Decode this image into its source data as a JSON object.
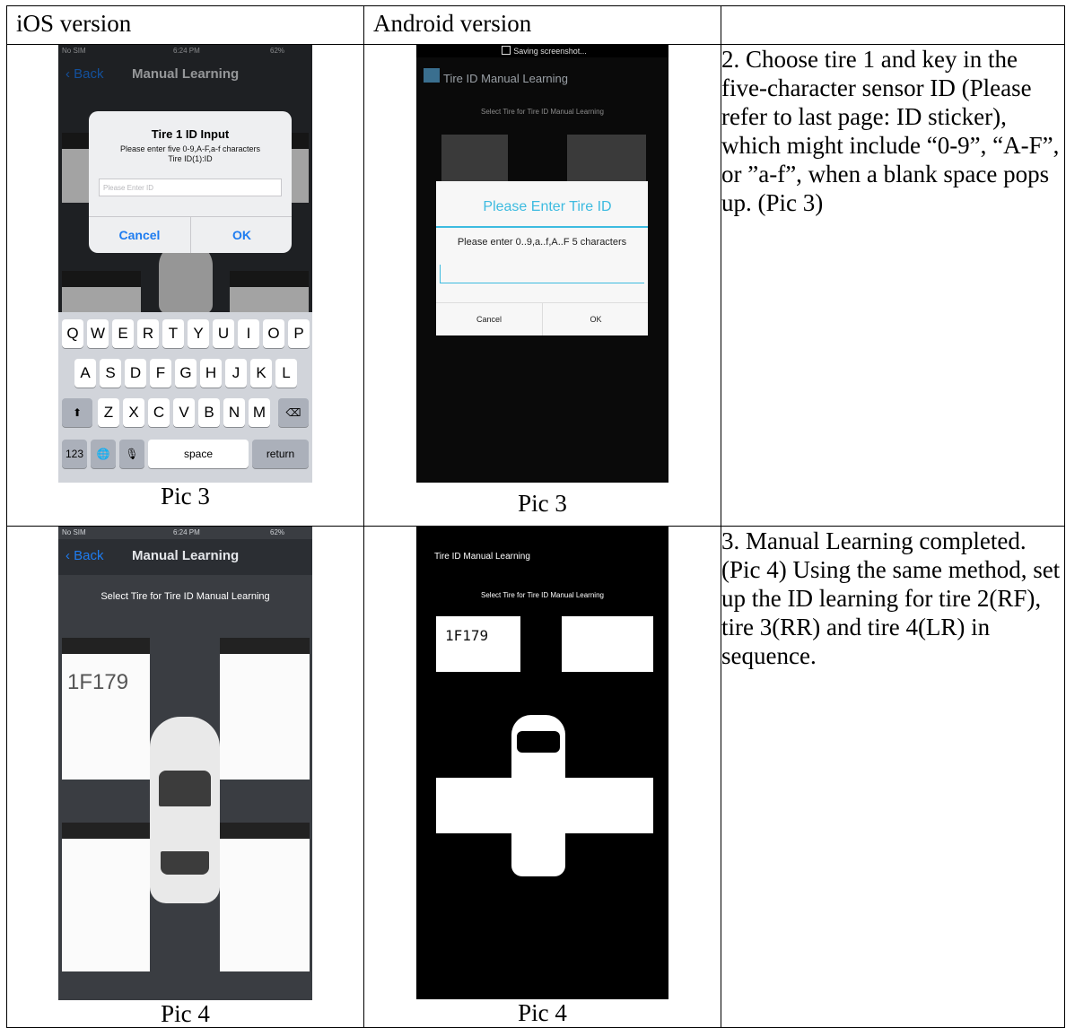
{
  "headers": {
    "ios": "iOS version",
    "android": "Android version",
    "empty": ""
  },
  "row1": {
    "ios": {
      "status_carrier": "No SIM",
      "status_time": "6:24 PM",
      "status_battery": "62%",
      "back": "Back",
      "title": "Manual Learning",
      "dialog_title": "Tire 1 ID Input",
      "dialog_msg1": "Please enter five 0-9,A-F,a-f characters",
      "dialog_msg2": "Tire ID(1):ID",
      "dialog_placeholder": "Please Enter ID",
      "cancel": "Cancel",
      "ok": "OK",
      "keys_row1": [
        "Q",
        "W",
        "E",
        "R",
        "T",
        "Y",
        "U",
        "I",
        "O",
        "P"
      ],
      "keys_row2": [
        "A",
        "S",
        "D",
        "F",
        "G",
        "H",
        "J",
        "K",
        "L"
      ],
      "keys_row3": [
        "Z",
        "X",
        "C",
        "V",
        "B",
        "N",
        "M"
      ],
      "key_123": "123",
      "key_space": "space",
      "key_return": "return"
    },
    "android": {
      "status": "Saving screenshot...",
      "title": "Tire ID Manual Learning",
      "subtitle": "Select Tire for Tire ID Manual Learning",
      "dialog_title": "Please Enter Tire ID",
      "dialog_msg": "Please enter 0..9,a..f,A..F 5 characters",
      "cancel": "Cancel",
      "ok": "OK"
    },
    "caption_ios": "Pic 3",
    "caption_android": "Pic 3",
    "description": "2. Choose tire 1 and key in the five-character sensor ID (Please refer to last page: ID sticker), which might include “0-9”, “A-F”, or ”a-f”, when a blank space pops up. (Pic 3)"
  },
  "row2": {
    "ios": {
      "status_carrier": "No SIM",
      "status_time": "6:24 PM",
      "status_battery": "62%",
      "back": "Back",
      "title": "Manual Learning",
      "subtitle": "Select Tire for Tire ID Manual Learning",
      "tire1_id": "1F179"
    },
    "android": {
      "title": "Tire ID Manual Learning",
      "subtitle": "Select Tire for Tire ID Manual Learning",
      "tire1_id": "1F179"
    },
    "caption_ios": "Pic 4",
    "caption_android": "Pic 4",
    "description": "3. Manual Learning completed. (Pic 4) Using the same method, set up the ID learning for tire 2(RF), tire 3(RR) and tire 4(LR) in sequence."
  }
}
